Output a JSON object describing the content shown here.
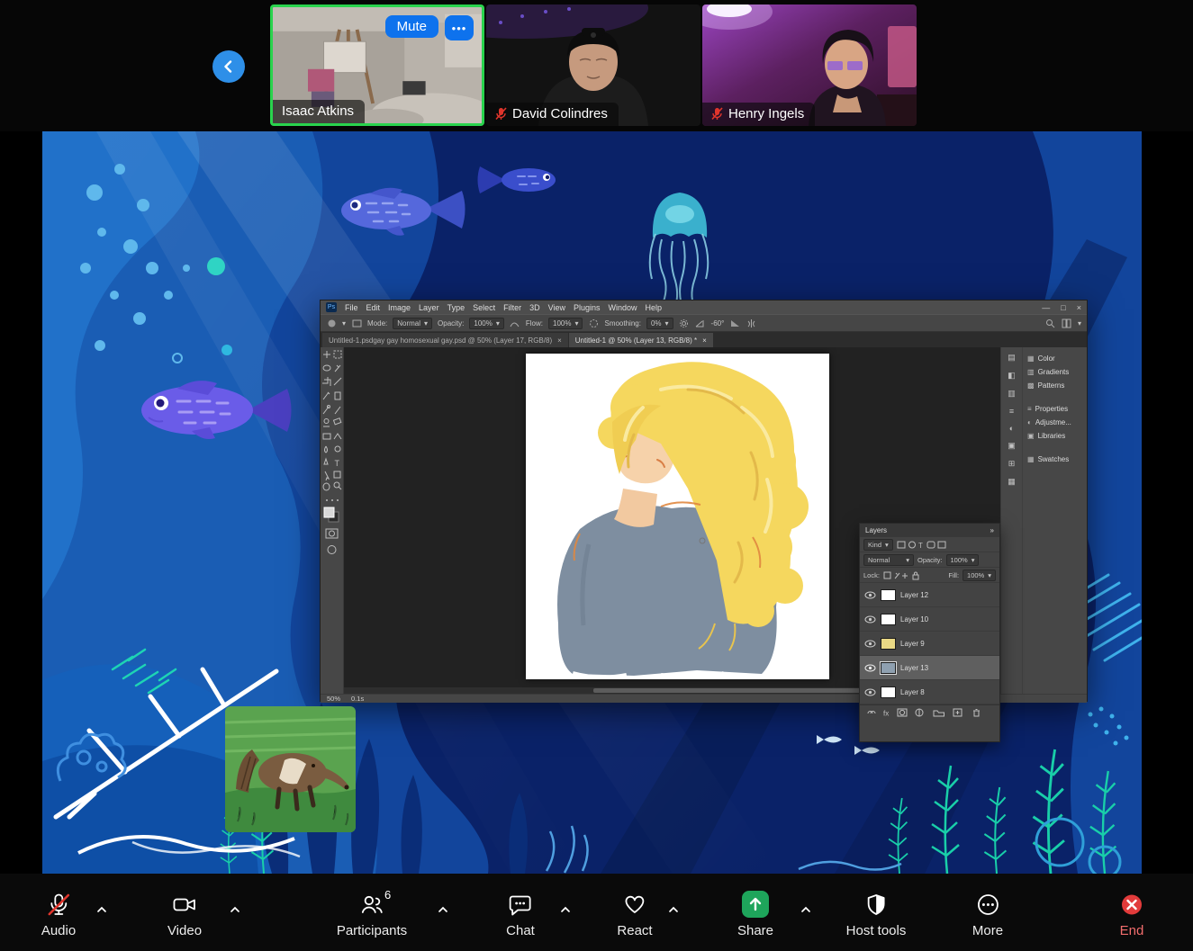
{
  "meeting": {
    "tiles": [
      {
        "name": "Isaac Atkins",
        "mute_button": "Mute",
        "muted": false
      },
      {
        "name": "David Colindres",
        "muted": true
      },
      {
        "name": "Henry Ingels",
        "muted": true
      }
    ]
  },
  "photoshop": {
    "menu": [
      "File",
      "Edit",
      "Image",
      "Layer",
      "Type",
      "Select",
      "Filter",
      "3D",
      "View",
      "Plugins",
      "Window",
      "Help"
    ],
    "options_bar": {
      "mode_label": "Mode:",
      "mode_value": "Normal",
      "opacity_label": "Opacity:",
      "opacity_value": "100%",
      "flow_label": "Flow:",
      "flow_value": "100%",
      "smoothing_label": "Smoothing:",
      "smoothing_value": "0%",
      "angle_value": "-60°"
    },
    "tabs": [
      {
        "label": "Untitled-1.psdgay gay homosexual gay.psd @ 50% (Layer 17, RGB/8)"
      },
      {
        "label": "Untitled-1 @ 50% (Layer 13, RGB/8) *"
      }
    ],
    "right_panels": [
      "Color",
      "Gradients",
      "Patterns",
      "Properties",
      "Adjustme...",
      "Libraries",
      "Swatches"
    ],
    "layers_panel": {
      "title": "Layers",
      "kind_filter": "Kind",
      "blend_mode": "Normal",
      "opacity_label": "Opacity:",
      "opacity_value": "100%",
      "lock_label": "Lock:",
      "fill_label": "Fill:",
      "fill_value": "100%",
      "layers": [
        {
          "name": "Layer 12"
        },
        {
          "name": "Layer 10"
        },
        {
          "name": "Layer 9"
        },
        {
          "name": "Layer 13"
        },
        {
          "name": "Layer 8"
        }
      ]
    },
    "status_bar": {
      "zoom": "50%",
      "timing": "0.1s"
    }
  },
  "toolbar": {
    "audio": "Audio",
    "video": "Video",
    "participants": "Participants",
    "participants_count": "6",
    "chat": "Chat",
    "react": "React",
    "share": "Share",
    "host_tools": "Host tools",
    "more": "More",
    "end": "End"
  },
  "glyphs": {
    "close_x": "×",
    "caret": "▾",
    "minimize": "—",
    "restore": "□",
    "dots": "•••",
    "double_chevron": "»",
    "ps_icon": "Ps",
    "fx": "fx"
  }
}
